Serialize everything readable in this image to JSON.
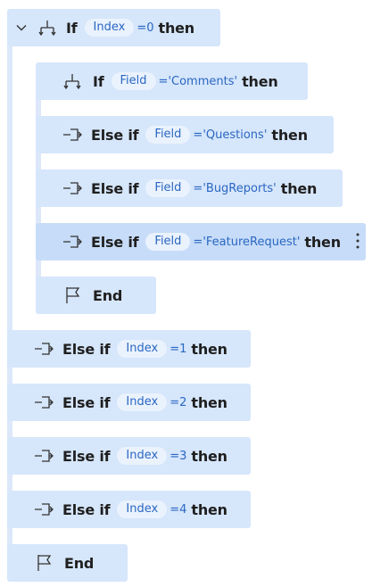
{
  "outer": {
    "if_keyword": "If",
    "if_variable": "Index",
    "if_operator": "=",
    "if_value": "0",
    "then_keyword": "then",
    "inner": {
      "if_keyword": "If",
      "if_variable": "Field",
      "if_operator": "=",
      "if_value": "'Comments'",
      "then_keyword": "then",
      "else_ifs": [
        {
          "keyword": "Else if",
          "variable": "Field",
          "operator": "=",
          "value": "'Questions'",
          "then": "then"
        },
        {
          "keyword": "Else if",
          "variable": "Field",
          "operator": "=",
          "value": "'BugReports'",
          "then": "then"
        },
        {
          "keyword": "Else if",
          "variable": "Field",
          "operator": "=",
          "value": "'FeatureRequest'",
          "then": "then"
        }
      ],
      "end_label": "End"
    },
    "else_ifs": [
      {
        "keyword": "Else if",
        "variable": "Index",
        "operator": "=",
        "value": "1",
        "then": "then"
      },
      {
        "keyword": "Else if",
        "variable": "Index",
        "operator": "=",
        "value": "2",
        "then": "then"
      },
      {
        "keyword": "Else if",
        "variable": "Index",
        "operator": "=",
        "value": "3",
        "then": "then"
      },
      {
        "keyword": "Else if",
        "variable": "Index",
        "operator": "=",
        "value": "4",
        "then": "then"
      }
    ],
    "end_label": "End"
  },
  "colors": {
    "block": "#d6e6fb",
    "selected_block": "#c7dcf8",
    "rail": "#dce8fa",
    "variable_text": "#2a67c2",
    "variable_pill": "#eaf2fd"
  },
  "icons": {
    "collapse": "chevron-down-icon",
    "if": "if-branch-icon",
    "else_if": "else-if-branch-icon",
    "end": "flag-icon",
    "more": "more-vertical-icon"
  }
}
